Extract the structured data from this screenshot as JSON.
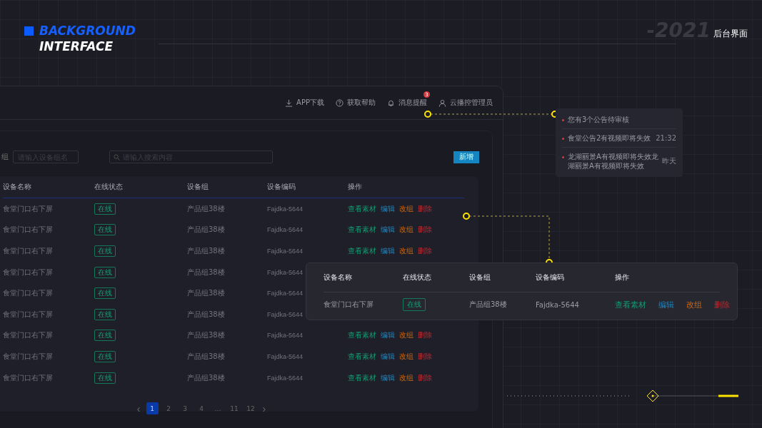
{
  "brand": {
    "line1": "BACKGROUND",
    "line2": "INTERFACE"
  },
  "corner": {
    "year": "-2021",
    "title": "后台界面"
  },
  "topbar": [
    {
      "kind": "download",
      "label": "APP下载"
    },
    {
      "kind": "help",
      "label": "获取帮助"
    },
    {
      "kind": "bell",
      "label": "消息提醒",
      "badge": "3"
    },
    {
      "kind": "user",
      "label": "云播控管理员"
    }
  ],
  "filters": {
    "label": "组",
    "group": {
      "placeholder": "请输入设备组名"
    },
    "search": {
      "placeholder": "请输入搜索内容"
    },
    "add_button": "新增"
  },
  "table": {
    "columns": [
      "设备名称",
      "在线状态",
      "设备组",
      "设备编码",
      "操作"
    ],
    "rows": [
      {
        "name": "食堂门口右下屏",
        "status": "在线",
        "group": "产品组38楼",
        "code": "Fajdka-5644",
        "actions": [
          "查看素材",
          "编辑",
          "改组",
          "删除"
        ]
      },
      {
        "name": "食堂门口右下屏",
        "status": "在线",
        "group": "产品组38楼",
        "code": "Fajdka-5644",
        "actions": [
          "查看素材",
          "编辑",
          "改组",
          "删除"
        ]
      },
      {
        "name": "食堂门口右下屏",
        "status": "在线",
        "group": "产品组38楼",
        "code": "Fajdka-5644",
        "actions": [
          "查看素材",
          "编辑",
          "改组",
          "删除"
        ]
      },
      {
        "name": "食堂门口右下屏",
        "status": "在线",
        "group": "产品组38楼",
        "code": "Fajdka-5644"
      },
      {
        "name": "食堂门口右下屏",
        "status": "在线",
        "group": "产品组38楼",
        "code": "Fajdka-5644"
      },
      {
        "name": "食堂门口右下屏",
        "status": "在线",
        "group": "产品组38楼",
        "code": "Fajdka-5644"
      },
      {
        "name": "食堂门口右下屏",
        "status": "在线",
        "group": "产品组38楼",
        "code": "Fajdka-5644",
        "actions": [
          "查看素材",
          "编辑",
          "改组",
          "删除"
        ]
      },
      {
        "name": "食堂门口右下屏",
        "status": "在线",
        "group": "产品组38楼",
        "code": "Fajdka-5644",
        "actions": [
          "查看素材",
          "编辑",
          "改组",
          "删除"
        ]
      },
      {
        "name": "食堂门口右下屏",
        "status": "在线",
        "group": "产品组38楼",
        "code": "Fajdka-5644",
        "actions": [
          "查看素材",
          "编辑",
          "改组",
          "删除"
        ]
      }
    ]
  },
  "pagination": {
    "prev": "‹",
    "next": "›",
    "pages": [
      {
        "label": "1",
        "selected": true
      },
      {
        "label": "2",
        "selected": false
      },
      {
        "label": "3",
        "selected": false
      },
      {
        "label": "4",
        "selected": false
      },
      {
        "label": "…",
        "selected": false
      },
      {
        "label": "11",
        "selected": false
      },
      {
        "label": "12",
        "selected": false
      }
    ]
  },
  "notifications": [
    {
      "text": "您有3个公告待审核"
    },
    {
      "text": "食堂公告2有视频即将失效",
      "time": "21:32"
    },
    {
      "text": "龙湖丽景A有视频即将失效龙湖丽景A有视频即将失效",
      "time": "昨天"
    }
  ],
  "detail": {
    "columns": [
      "设备名称",
      "在线状态",
      "设备组",
      "设备编码",
      "操作"
    ],
    "row": {
      "name": "食堂门口右下屏",
      "status": "在线",
      "group": "产品组38楼",
      "code": "Fajdka-5644",
      "actions": [
        "查看素材",
        "编辑",
        "改组",
        "删除"
      ]
    }
  }
}
